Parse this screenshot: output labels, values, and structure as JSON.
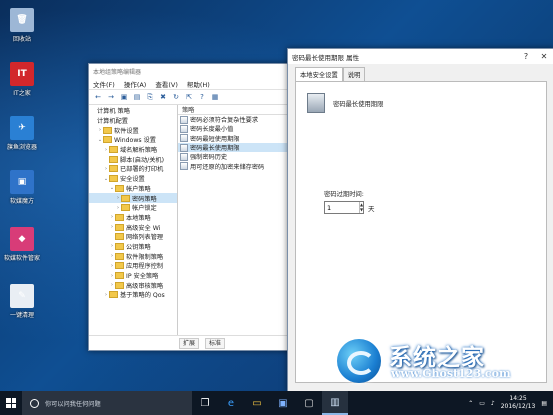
{
  "desktop": {
    "icons": [
      {
        "label": "回收站",
        "glyph": "🗑",
        "color": "#9db7d6"
      },
      {
        "label": "IT之家",
        "glyph": "IT",
        "color": "#d2272c"
      },
      {
        "label": "旗鱼浏览器",
        "glyph": "✈",
        "color": "#2a80d4"
      },
      {
        "label": "软媒魔方",
        "glyph": "▣",
        "color": "#2f73c9"
      },
      {
        "label": "软媒软件管家",
        "glyph": "◆",
        "color": "#d83c78"
      },
      {
        "label": "一键清理",
        "glyph": "✎",
        "color": "#e9eef4"
      }
    ]
  },
  "gpe": {
    "title": "本地组策略编辑器",
    "menu": [
      "文件(F)",
      "操作(A)",
      "查看(V)",
      "帮助(H)"
    ],
    "toolbar_icons": [
      "back-arrow-icon",
      "forward-arrow-icon",
      "up-folder-icon",
      "show-tree-icon",
      "copy-icon",
      "delete-icon",
      "refresh-icon",
      "export-icon",
      "help-icon",
      "properties-icon"
    ],
    "tree": [
      {
        "label": "计算机 策略",
        "indent": 0,
        "exp": "",
        "folder": false
      },
      {
        "label": "计算机配置",
        "indent": 0,
        "exp": "",
        "folder": false
      },
      {
        "label": "软件设置",
        "indent": 1,
        "exp": "›",
        "folder": true
      },
      {
        "label": "Windows 设置",
        "indent": 1,
        "exp": "⌄",
        "folder": true
      },
      {
        "label": "域名解析策略",
        "indent": 2,
        "exp": "›",
        "folder": true
      },
      {
        "label": "脚本(启动/关机)",
        "indent": 2,
        "exp": "",
        "folder": true
      },
      {
        "label": "已部署的打印机",
        "indent": 2,
        "exp": "›",
        "folder": true
      },
      {
        "label": "安全设置",
        "indent": 2,
        "exp": "⌄",
        "folder": true
      },
      {
        "label": "帐户策略",
        "indent": 3,
        "exp": "⌄",
        "folder": true
      },
      {
        "label": "密码策略",
        "indent": 4,
        "exp": "›",
        "folder": true,
        "sel": true
      },
      {
        "label": "帐户锁定",
        "indent": 4,
        "exp": "›",
        "folder": true
      },
      {
        "label": "本地策略",
        "indent": 3,
        "exp": "›",
        "folder": true
      },
      {
        "label": "高级安全 Wi",
        "indent": 3,
        "exp": "›",
        "folder": true
      },
      {
        "label": "网络列表管理",
        "indent": 3,
        "exp": "",
        "folder": true
      },
      {
        "label": "公钥策略",
        "indent": 3,
        "exp": "›",
        "folder": true
      },
      {
        "label": "软件限制策略",
        "indent": 3,
        "exp": "›",
        "folder": true
      },
      {
        "label": "应用程序控制",
        "indent": 3,
        "exp": "›",
        "folder": true
      },
      {
        "label": "IP 安全策略",
        "indent": 3,
        "exp": "›",
        "folder": true
      },
      {
        "label": "高级审核策略",
        "indent": 3,
        "exp": "›",
        "folder": true
      },
      {
        "label": "基于策略的 Qos",
        "indent": 2,
        "exp": "›",
        "folder": true
      }
    ],
    "list_header": "策略",
    "policies": [
      {
        "label": "密码必须符合复杂性要求"
      },
      {
        "label": "密码长度最小值"
      },
      {
        "label": "密码最短使用期限"
      },
      {
        "label": "密码最长使用期限",
        "sel": true
      },
      {
        "label": "强制密码历史"
      },
      {
        "label": "用可还原的加密来储存密码"
      }
    ],
    "status_tabs": [
      "扩展",
      "标准"
    ]
  },
  "prop": {
    "title": "密码最长使用期限 属性",
    "tabs": [
      "本地安全设置",
      "说明"
    ],
    "policy_name": "密码最长使用期限",
    "field_label": "密码过期时间:",
    "value": "1",
    "unit": "天"
  },
  "watermark": {
    "cn": "系统之家",
    "url": "www.Ghost123.com"
  },
  "taskbar": {
    "search_placeholder": "你可以问我任何问题",
    "apps": [
      "task-view-icon",
      "edge-icon",
      "file-explorer-icon",
      "store-icon",
      "app-icon",
      "gpe-app-icon"
    ],
    "time": "14:25",
    "date": "2016/12/13"
  }
}
